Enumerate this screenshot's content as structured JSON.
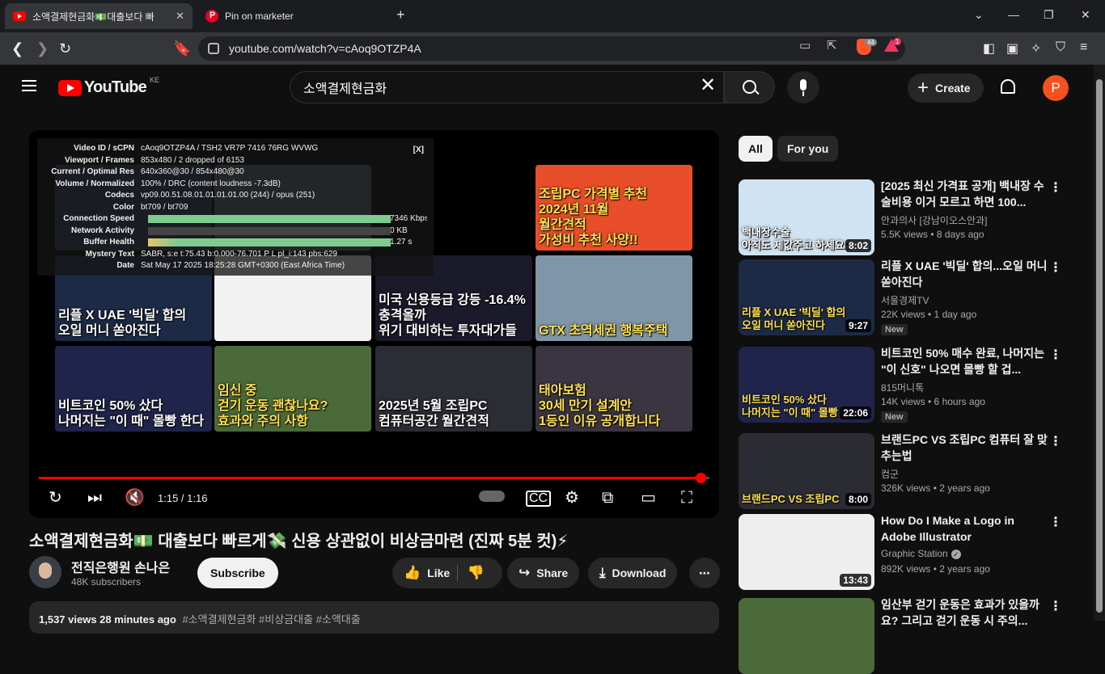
{
  "browser": {
    "tabs": [
      {
        "title": "소액결제현금화💵대출보다 빠",
        "active": true
      },
      {
        "title": "Pin on marketer",
        "active": false
      }
    ],
    "new_tab": "+",
    "url": "youtube.com/watch?v=cAoq9OTZP4A",
    "badges": {
      "brave": "44",
      "alert": "1"
    }
  },
  "youtube": {
    "region": "KE",
    "logo_text": "YouTube",
    "search_value": "소액결제현금화",
    "create_label": "Create",
    "avatar_letter": "P"
  },
  "player": {
    "time": "1:15 / 1:16",
    "progress_fraction": 0.987,
    "stats_close": "[X]",
    "stats": [
      {
        "k": "Video ID / sCPN",
        "v": "cAoq9OTZP4A  /  TSH2  VR7P  7416  76RG  WVWG"
      },
      {
        "k": "Viewport / Frames",
        "v": "853x480 / 2 dropped of 6153"
      },
      {
        "k": "Current / Optimal Res",
        "v": "640x360@30 / 854x480@30"
      },
      {
        "k": "Volume / Normalized",
        "v": "100% / DRC (content loudness -7.3dB)"
      },
      {
        "k": "Codecs",
        "v": "vp09.00.51.08.01.01.01.01.00 (244) / opus (251)"
      },
      {
        "k": "Color",
        "v": "bt709 / bt709"
      },
      {
        "k": "Connection Speed",
        "v": "7346 Kbps",
        "meter": true
      },
      {
        "k": "Network Activity",
        "v": "0 KB",
        "meter": true
      },
      {
        "k": "Buffer Health",
        "v": "1.27 s",
        "meter": true
      },
      {
        "k": "Mystery Text",
        "v": "SABR, s:e t:75.43 b:0.000-76.701 P L pl_i:143 pbs:629"
      },
      {
        "k": "Date",
        "v": "Sat May 17 2025 18:25:28 GMT+0300 (East Africa Time)"
      }
    ],
    "endcards": [
      {
        "text": "",
        "bg": "#2b3a55"
      },
      {
        "text": "",
        "bg": "#556470"
      },
      {
        "text": "조립PC 가격별 추천\n2024년 11월\n월간견적\n가성비 추천 사양!!",
        "bg": "#e94e2a"
      },
      {
        "text": "리플 X UAE '빅딜' 합의\n오일 머니 쏟아진다",
        "bg": "#1d2a45"
      },
      {
        "text": "",
        "bg": "#f2f2f2"
      },
      {
        "text": "미국 신용등급 강등 -16.4% 충격올까\n위기 대비하는 투자대가들",
        "bg": "#1a1a2a"
      },
      {
        "text": "GTX 초역세권 행복주택",
        "bg": "#7f95a8"
      },
      {
        "text": "비트코인 50% 샀다\n나머지는 \"이 때\" 몰빵 한다",
        "bg": "#20244a"
      },
      {
        "text": "임신 중\n걷기 운동 괜찮나요?\n효과와 주의 사항",
        "bg": "#4b6a3a"
      },
      {
        "text": "2025년 5월 조립PC\n컴퓨터공간 월간견적",
        "bg": "#2c2c34"
      },
      {
        "text": "태아보험\n30세 만기 설계안\n1등인 이유 공개합니다",
        "bg": "#3a3540"
      }
    ]
  },
  "video": {
    "title": "소액결제현금화💵 대출보다 빠르게💸 신용 상관없이 비상금마련 (진짜 5분 컷)⚡",
    "channel": "전직은행원 손나은",
    "subscribers": "48K subscribers",
    "subscribe_label": "Subscribe",
    "like_label": "Like",
    "share_label": "Share",
    "download_label": "Download",
    "views": "1,537 views  28 minutes ago",
    "tags": "#소액결제현금화 #비상금대출 #소액대출"
  },
  "sidebar": {
    "chips": [
      "All",
      "For you"
    ],
    "items": [
      {
        "title": "[2025 최신 가격표 공개] 백내장 수술비용 이거 모르고 하면 100...",
        "channel": "안과의사 [강남이오스안과]",
        "meta": "5.5K views  •  8 days ago",
        "duration": "8:02",
        "thumb_text": "백내장수술\n아직도 제값주고 하세요?",
        "thumb_bg": "#cfe3f2",
        "badge": ""
      },
      {
        "title": "리플 X UAE '빅딜' 합의...오일 머니 쏟아진다",
        "channel": "서울경제TV",
        "meta": "22K views  •  1 day ago",
        "duration": "9:27",
        "thumb_text": "리플 X UAE '빅딜' 합의\n오일 머니 쏟아진다",
        "thumb_bg": "#1d2a45",
        "badge": "New"
      },
      {
        "title": "비트코인 50% 매수 완료, 나머지는 \"이 신호\" 나오면 몰빵 할 겁...",
        "channel": "815머니톡",
        "meta": "14K views  •  6 hours ago",
        "duration": "22:06",
        "thumb_text": "비트코인 50% 샀다\n나머지는 \"이 때\" 몰빵",
        "thumb_bg": "#20244a",
        "badge": "New"
      },
      {
        "title": "브랜드PC VS 조립PC 컴퓨터 잘 맞추는법",
        "channel": "컴군",
        "meta": "326K views  •  2 years ago",
        "duration": "8:00",
        "thumb_text": "브랜드PC  VS  조립PC",
        "thumb_bg": "#2b2b33",
        "badge": ""
      },
      {
        "title": "How Do I Make a Logo in Adobe Illustrator",
        "channel": "Graphic Station",
        "meta": "892K views  •  2 years ago",
        "duration": "13:43",
        "thumb_text": "",
        "thumb_bg": "#eeeeee",
        "badge": "",
        "verified": true
      },
      {
        "title": "임산부 걷기 운동은 효과가 있을까요? 그리고 걷기 운동 시 주의...",
        "channel": "",
        "meta": "",
        "duration": "",
        "thumb_text": "",
        "thumb_bg": "#4b6a3a",
        "badge": ""
      }
    ]
  },
  "colors": {
    "accent": "#ff0000",
    "bg": "#0f0f0f",
    "chip": "#272727"
  }
}
